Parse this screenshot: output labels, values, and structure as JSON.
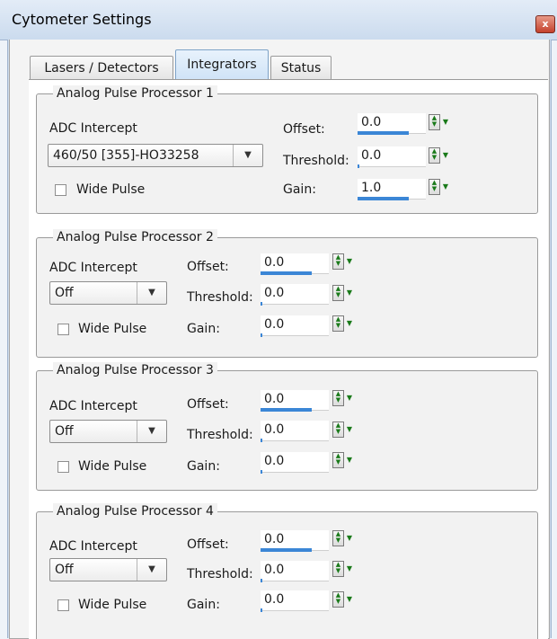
{
  "window": {
    "title": "Cytometer Settings",
    "close_glyph": "x"
  },
  "tabs": [
    {
      "label": "Lasers / Detectors",
      "active": false
    },
    {
      "label": "Integrators",
      "active": true
    },
    {
      "label": "Status",
      "active": false
    }
  ],
  "labels": {
    "adc_intercept": "ADC Intercept",
    "wide_pulse": "Wide Pulse",
    "offset": "Offset:",
    "threshold": "Threshold:",
    "gain": "Gain:"
  },
  "processors": [
    {
      "title": "Analog Pulse Processor 1",
      "adc_value": "460/50 [355]-HO33258",
      "wide_pulse_checked": false,
      "offset": "0.0",
      "threshold": "0.0",
      "gain": "1.0",
      "offset_level": 0.75,
      "threshold_level": 0.03,
      "gain_level": 0.75
    },
    {
      "title": "Analog Pulse Processor 2",
      "adc_value": "Off",
      "wide_pulse_checked": false,
      "offset": "0.0",
      "threshold": "0.0",
      "gain": "0.0",
      "offset_level": 0.75,
      "threshold_level": 0.03,
      "gain_level": 0.03
    },
    {
      "title": "Analog Pulse Processor 3",
      "adc_value": "Off",
      "wide_pulse_checked": false,
      "offset": "0.0",
      "threshold": "0.0",
      "gain": "0.0",
      "offset_level": 0.75,
      "threshold_level": 0.03,
      "gain_level": 0.03
    },
    {
      "title": "Analog Pulse Processor 4",
      "adc_value": "Off",
      "wide_pulse_checked": false,
      "offset": "0.0",
      "threshold": "0.0",
      "gain": "0.0",
      "offset_level": 0.75,
      "threshold_level": 0.03,
      "gain_level": 0.03
    }
  ],
  "icons": {
    "spin_updown": "spin-up-down-icon",
    "spin_dropdown": "spin-menu-icon",
    "dropdown_arrow": "chevron-down-icon"
  },
  "colors": {
    "level_bar": "#3b86d6",
    "spin_arrow": "#1a7a1a"
  }
}
